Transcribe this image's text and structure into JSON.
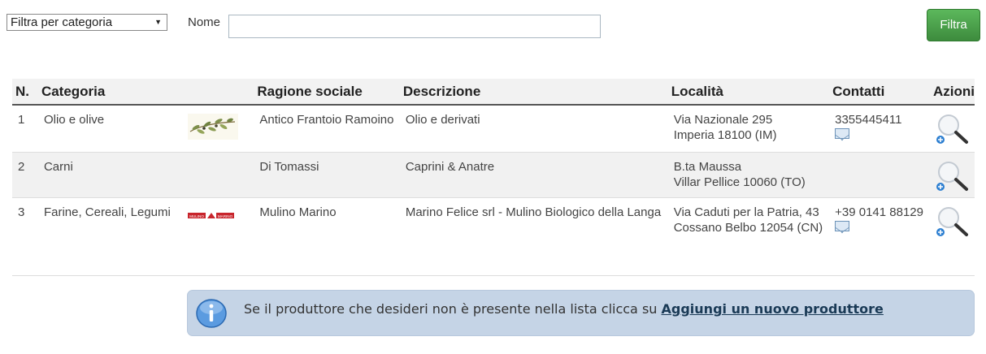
{
  "filters": {
    "category_select": "Filtra per categoria",
    "name_label": "Nome",
    "name_value": "",
    "submit_label": "Filtra"
  },
  "table": {
    "headers": {
      "num": "N.",
      "category": "Categoria",
      "business_name": "Ragione sociale",
      "description": "Descrizione",
      "location": "Località",
      "contacts": "Contatti",
      "actions": "Azioni"
    },
    "rows": [
      {
        "num": "1",
        "category": "Olio e olive",
        "logo": "olive-branch-logo",
        "business_name": "Antico Frantoio Ramoino",
        "description": "Olio e derivati",
        "address": "Via Nazionale 295",
        "city": "Imperia 18100 (IM)",
        "phone": "3355445411",
        "has_email": true
      },
      {
        "num": "2",
        "category": "Carni",
        "logo": "",
        "business_name": "Di Tomassi",
        "description": "Caprini & Anatre",
        "address": "B.ta Maussa",
        "city": "Villar Pellice 10060 (TO)",
        "phone": "",
        "has_email": false
      },
      {
        "num": "3",
        "category": "Farine, Cereali, Legumi",
        "logo": "mulino-marino-logo",
        "business_name": "Mulino Marino",
        "description": "Marino Felice srl - Mulino Biologico della Langa",
        "address": "Via Caduti per la Patria, 43",
        "city": "Cossano Belbo 12054 (CN)",
        "phone": "+39 0141 88129",
        "has_email": true
      }
    ]
  },
  "notice": {
    "text": "Se il produttore che desideri non è presente nella lista clicca su ",
    "link": "Aggiungi un nuovo produttore"
  },
  "logo_texts": {
    "mulino": "MULINO MARINO"
  }
}
